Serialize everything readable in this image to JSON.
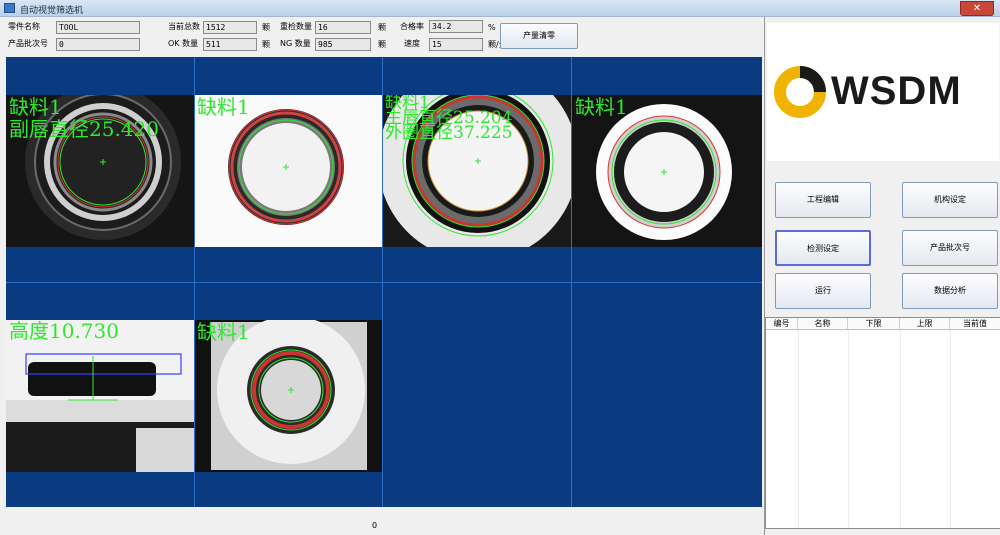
{
  "window": {
    "title": "自动视觉筛选机",
    "close_glyph": "✕"
  },
  "info": {
    "part_name_label": "零件名称",
    "part_name_value": "TOOL",
    "batch_label": "产品批次号",
    "batch_value": "0",
    "total_label": "当前总数",
    "total_value": "1512",
    "total_unit": "颗",
    "ok_label": "OK 数量",
    "ok_value": "511",
    "ok_unit": "颗",
    "recheck_label": "重检数量",
    "recheck_value": "16",
    "recheck_unit": "颗",
    "ng_label": "NG 数量",
    "ng_value": "985",
    "ng_unit": "颗",
    "pass_rate_label": "合格率",
    "pass_rate_value": "34.2",
    "pass_rate_unit": "%",
    "speed_label": "速度",
    "speed_value": "15",
    "speed_unit": "颗/分",
    "reset_button": "产量清零"
  },
  "cameras": [
    {
      "lines": [
        "缺料1",
        "副唇直径25.420"
      ]
    },
    {
      "lines": [
        "缺料1"
      ]
    },
    {
      "lines": [
        "缺料1",
        "主唇直径25.204",
        "外圈直径37.225"
      ]
    },
    {
      "lines": [
        "缺料1"
      ]
    },
    {
      "lines": [
        "高度10.730"
      ]
    },
    {
      "lines": [
        "缺料1"
      ]
    }
  ],
  "status": {
    "value": "0"
  },
  "logo": {
    "text": "WSDM"
  },
  "buttons": {
    "project_edit": "工程编辑",
    "mechanism": "机构设定",
    "detect_setting": "检测设定",
    "batch_no": "产品批次号",
    "run": "运行",
    "data_analysis": "数据分析"
  },
  "table": {
    "headers": [
      "编号",
      "名称",
      "下限",
      "上限",
      "当前值"
    ]
  },
  "colors": {
    "grid_bg": "#0a3b80",
    "overlay_text": "#2ee82e"
  }
}
